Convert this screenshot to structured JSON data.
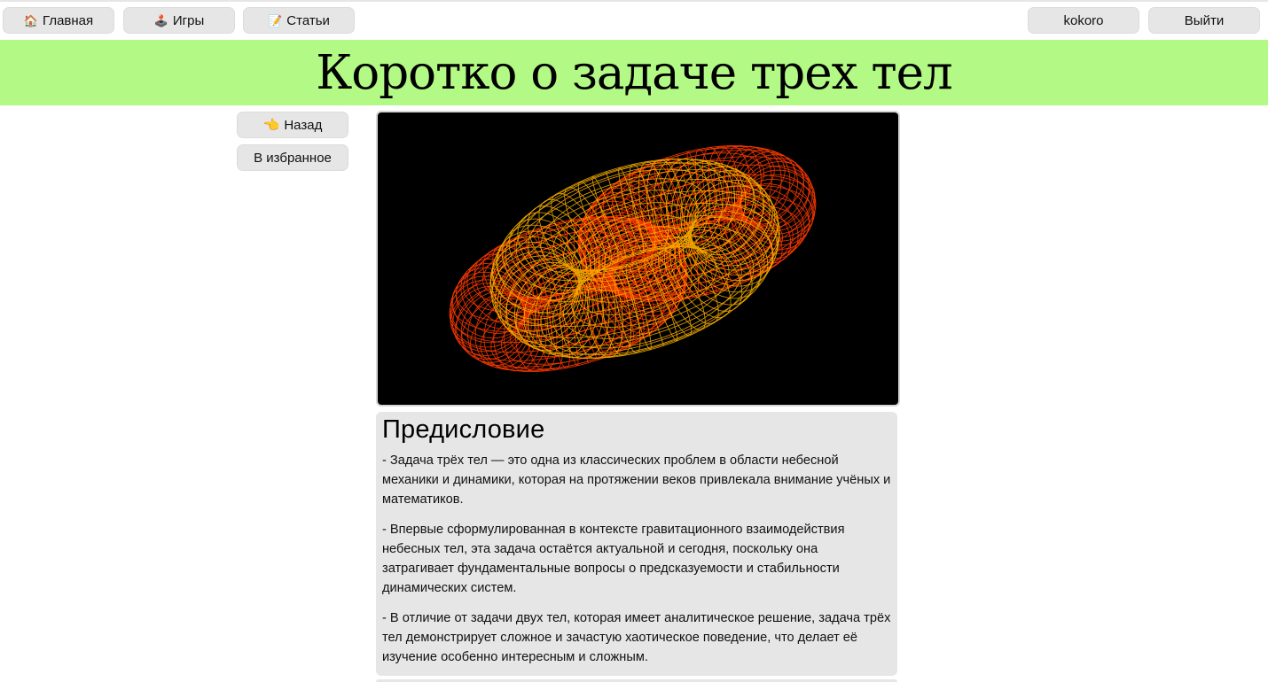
{
  "nav": {
    "left": [
      {
        "icon": "🏠",
        "icon_name": "house-icon",
        "label": "Главная"
      },
      {
        "icon": "🕹️",
        "icon_name": "joystick-icon",
        "label": "Игры"
      },
      {
        "icon": "📝",
        "icon_name": "memo-icon",
        "label": "Статьи"
      }
    ],
    "username": "kokoro",
    "logout_label": "Выйти"
  },
  "banner": {
    "title": "Коротко о задаче трех тел"
  },
  "sidebar": {
    "back_icon": "👈",
    "back_icon_name": "pointing-hand-icon",
    "back_label": "Назад",
    "favorite_label": "В избранное"
  },
  "figure": {
    "image_name": "three-body-torus-illustration"
  },
  "article": {
    "heading": "Предисловие",
    "paragraphs": [
      "- Задача трёх тел — это одна из классических проблем в области небесной механики и динамики, которая на протяжении веков привлекала внимание учёных и математиков.",
      "- Впервые сформулированная в контексте гравитационного взаимодействия небесных тел, эта задача остаётся актуальной и сегодня, поскольку она затрагивает фундаментальные вопросы о предсказуемости и стабильности динамических систем.",
      "- В отличие от задачи двух тел, которая имеет аналитическое решение, задача трёх тел демонстрирует сложное и зачастую хаотическое поведение, что делает её изучение особенно интересным и сложным."
    ]
  },
  "colors": {
    "banner_bg": "#b3f986",
    "button_bg": "#e6e6e6",
    "card_bg": "#e6e6e6",
    "figure_bg": "#000000",
    "torus_outer": "#ff3a00",
    "torus_inner": "#ffb400"
  }
}
